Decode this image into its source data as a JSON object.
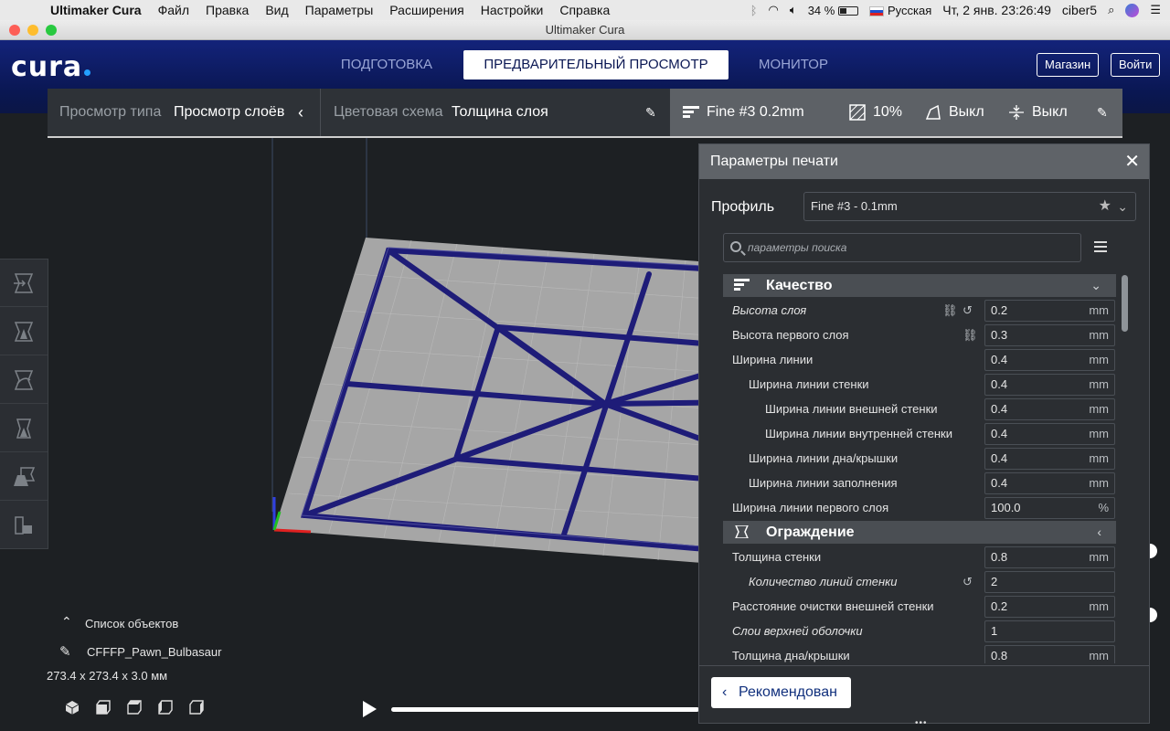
{
  "menubar": {
    "app": "Ultimaker Cura",
    "items": [
      "Файл",
      "Правка",
      "Вид",
      "Параметры",
      "Расширения",
      "Настройки",
      "Справка"
    ],
    "battery": "34 %",
    "input_source": "Русская",
    "datetime": "Чт, 2 янв.  23:26:49",
    "user": "ciber5"
  },
  "window": {
    "title": "Ultimaker Cura"
  },
  "header": {
    "logo": "cura",
    "stages": [
      "ПОДГОТОВКА",
      "ПРЕДВАРИТЕЛЬНЫЙ ПРОСМОТР",
      "МОНИТОР"
    ],
    "active_stage": "ПРЕДВАРИТЕЛЬНЫЙ ПРОСМОТР",
    "marketplace": "Магазин",
    "signin": "Войти"
  },
  "viewbar": {
    "view_type_label": "Просмотр типа",
    "view_type_value": "Просмотр слоёв",
    "color_scheme_label": "Цветовая схема",
    "color_scheme_value": "Толщина слоя"
  },
  "printbar": {
    "profile": "Fine #3 0.2mm",
    "infill": "10%",
    "support": "Выкл",
    "adhesion": "Выкл"
  },
  "object_list": {
    "title": "Список объектов",
    "object_name": "CFFFP_Pawn_Bulbasaur",
    "dimensions": "273.4 x 273.4 x 3.0 мм"
  },
  "panel": {
    "title": "Параметры печати",
    "profile_label": "Профиль",
    "profile_value": "Fine #3 - 0.1mm",
    "search_placeholder": "параметры поиска",
    "recommended_button": "Рекомендован",
    "categories": {
      "quality": "Качество",
      "shell": "Ограждение"
    },
    "settings": [
      {
        "label": "Высота слоя",
        "value": "0.2",
        "unit": "mm"
      },
      {
        "label": "Высота первого слоя",
        "value": "0.3",
        "unit": "mm"
      },
      {
        "label": "Ширина линии",
        "value": "0.4",
        "unit": "mm"
      },
      {
        "label": "Ширина линии стенки",
        "value": "0.4",
        "unit": "mm"
      },
      {
        "label": "Ширина линии внешней стенки",
        "value": "0.4",
        "unit": "mm"
      },
      {
        "label": "Ширина линии внутренней стенки",
        "value": "0.4",
        "unit": "mm"
      },
      {
        "label": "Ширина линии дна/крышки",
        "value": "0.4",
        "unit": "mm"
      },
      {
        "label": "Ширина линии заполнения",
        "value": "0.4",
        "unit": "mm"
      },
      {
        "label": "Ширина линии первого слоя",
        "value": "100.0",
        "unit": "%"
      },
      {
        "label": "Толщина стенки",
        "value": "0.8",
        "unit": "mm"
      },
      {
        "label": "Количество линий стенки",
        "value": "2",
        "unit": ""
      },
      {
        "label": "Расстояние очистки внешней стенки",
        "value": "0.2",
        "unit": "mm"
      },
      {
        "label": "Слои верхней оболочки",
        "value": "1",
        "unit": ""
      },
      {
        "label": "Толщина дна/крышки",
        "value": "0.8",
        "unit": "mm"
      }
    ]
  },
  "colors": {
    "header": "#0a1753",
    "accent": "#23a0ff",
    "build_plate": "#a8a8a8",
    "layer_lines": "#1f1d7a"
  }
}
